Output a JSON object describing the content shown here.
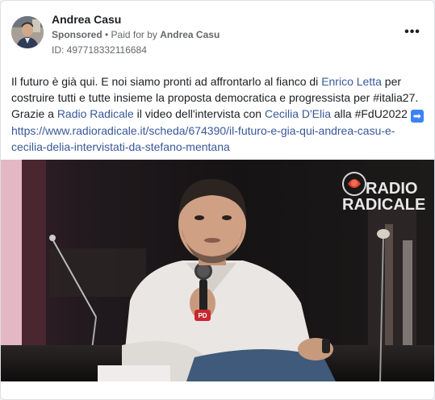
{
  "post": {
    "author_name": "Andrea Casu",
    "sponsored_label": "Sponsored",
    "separator": " • ",
    "paid_for_prefix": "Paid for by ",
    "paid_for_name": "Andrea Casu",
    "ad_id": "ID: 497718332116684",
    "more_label": "•••"
  },
  "text": {
    "p1": "Il futuro è già qui. E noi siamo pronti ad affrontarlo al fianco di ",
    "mention1": "Enrico Letta",
    "p2": " per costruire tutti e tutte insieme la proposta democratica e progressista per #italia27.",
    "p3": "Grazie a ",
    "mention2": "Radio Radicale",
    "p4": " il video dell'intervista con ",
    "mention3": "Cecilia D'Elia",
    "p5": " alla #FdU2022 ",
    "arrow": "➡",
    "url_line1": "https://www.radioradicale.it/scheda/674390/il-futuro-e-gia-qui-andrea-casu-e-",
    "url_line2": "cecilia-delia-intervistati-da-stefano-mentana"
  },
  "video": {
    "logo_top": "RADIO",
    "logo_bottom": "RADICALE",
    "mic_badge": "PD"
  },
  "colors": {
    "link": "#385898",
    "meta": "#65676b",
    "logo_rose": "#d9432f"
  }
}
